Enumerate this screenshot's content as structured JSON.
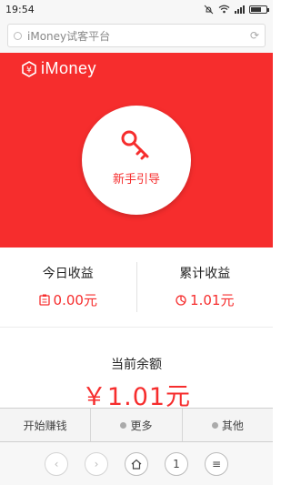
{
  "status_bar": {
    "time": "19:54"
  },
  "url_bar": {
    "text": "iMoney试客平台"
  },
  "hero": {
    "logo_text": "iMoney",
    "guide_label": "新手引导"
  },
  "earnings": [
    {
      "title": "今日收益",
      "value": "0.00元"
    },
    {
      "title": "累计收益",
      "value": "1.01元"
    }
  ],
  "balance": {
    "title": "当前余额",
    "amount": "￥1.01元"
  },
  "menu": [
    {
      "label": "开始赚钱"
    },
    {
      "label": "更多"
    },
    {
      "label": "其他"
    }
  ],
  "nav": {
    "tab_count": "1"
  },
  "colors": {
    "brand_red": "#f62d2d"
  }
}
